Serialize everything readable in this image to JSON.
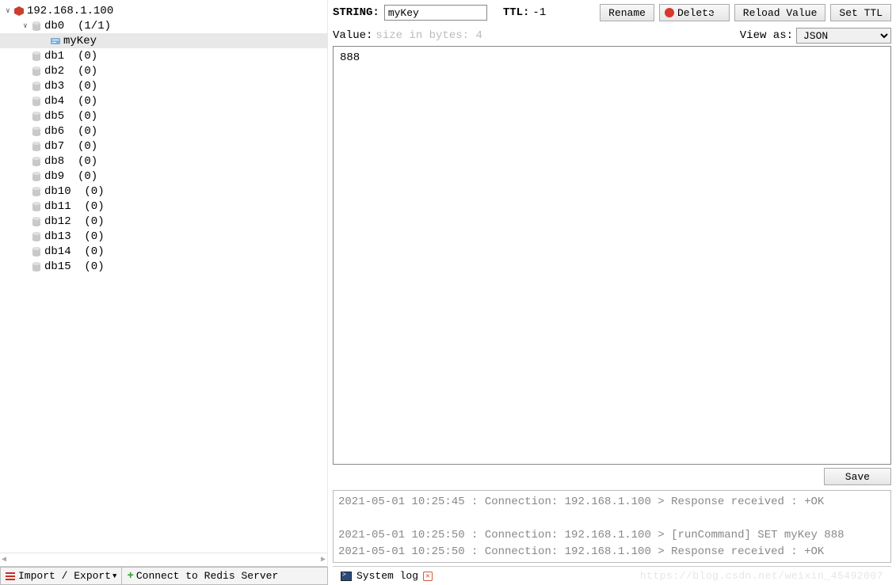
{
  "tree": {
    "server": "192.168.1.100",
    "databases": [
      {
        "name": "db0",
        "count": "(1/1)",
        "expanded": true,
        "keys": [
          {
            "name": "myKey",
            "selected": true
          }
        ]
      },
      {
        "name": "db1",
        "count": "(0)"
      },
      {
        "name": "db2",
        "count": "(0)"
      },
      {
        "name": "db3",
        "count": "(0)"
      },
      {
        "name": "db4",
        "count": "(0)"
      },
      {
        "name": "db5",
        "count": "(0)"
      },
      {
        "name": "db6",
        "count": "(0)"
      },
      {
        "name": "db7",
        "count": "(0)"
      },
      {
        "name": "db8",
        "count": "(0)"
      },
      {
        "name": "db9",
        "count": "(0)"
      },
      {
        "name": "db10",
        "count": "(0)"
      },
      {
        "name": "db11",
        "count": "(0)"
      },
      {
        "name": "db12",
        "count": "(0)"
      },
      {
        "name": "db13",
        "count": "(0)"
      },
      {
        "name": "db14",
        "count": "(0)"
      },
      {
        "name": "db15",
        "count": "(0)"
      }
    ]
  },
  "left_toolbar": {
    "import_export": "Import / Export",
    "connect": "Connect to Redis Server"
  },
  "header": {
    "type_label": "STRING:",
    "key_name": "myKey",
    "ttl_label": "TTL:",
    "ttl_value": "-1",
    "rename": "Rename",
    "delete": "Delete",
    "reload": "Reload Value",
    "set_ttl": "Set TTL"
  },
  "value": {
    "label": "Value:",
    "meta": "size in bytes: 4",
    "viewas_label": "View as:",
    "viewas_value": "JSON",
    "content": "888",
    "save": "Save"
  },
  "log": {
    "lines": [
      "2021-05-01 10:25:45 : Connection: 192.168.1.100 > Response received : +OK",
      "",
      "2021-05-01 10:25:50 : Connection: 192.168.1.100 > [runCommand] SET myKey 888",
      "2021-05-01 10:25:50 : Connection: 192.168.1.100 > Response received : +OK"
    ]
  },
  "bottom": {
    "system_log": "System log",
    "watermark": "https://blog.csdn.net/weixin_45492007"
  }
}
